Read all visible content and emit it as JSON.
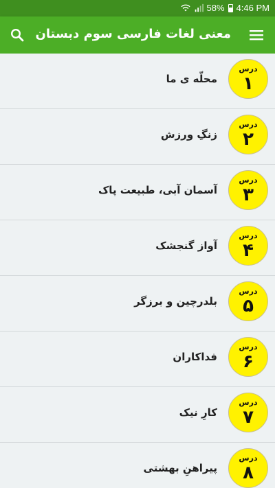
{
  "status_bar": {
    "battery": "58%",
    "time": "4:46 PM"
  },
  "app_bar": {
    "title": "معنی لغات فارسی سوم دبستان",
    "menu_icon": "hamburger-menu-icon",
    "search_icon": "search-icon"
  },
  "colors": {
    "status_bar": "#3f8f1f",
    "app_bar": "#4cae26",
    "badge": "#fff200",
    "background": "#eef2f3"
  },
  "lessons": [
    {
      "badge_word": "درس",
      "number": "۱",
      "title": "محلّه ی ما"
    },
    {
      "badge_word": "درس",
      "number": "۲",
      "title": "زنگِ ورزش"
    },
    {
      "badge_word": "درس",
      "number": "۳",
      "title": "آسمان آبی، طبیعت پاک"
    },
    {
      "badge_word": "درس",
      "number": "۴",
      "title": "آواز گنجشک"
    },
    {
      "badge_word": "درس",
      "number": "۵",
      "title": "بلدرچین و برزگر"
    },
    {
      "badge_word": "درس",
      "number": "۶",
      "title": "فداکاران"
    },
    {
      "badge_word": "درس",
      "number": "۷",
      "title": "کارِ نیک"
    },
    {
      "badge_word": "درس",
      "number": "۸",
      "title": "پیراهنِ بهشتی"
    }
  ]
}
